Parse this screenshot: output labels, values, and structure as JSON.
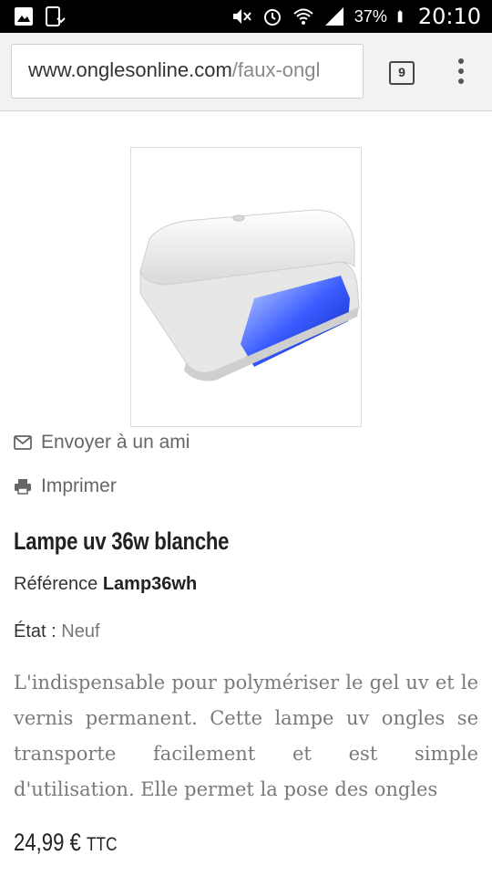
{
  "status_bar": {
    "battery_percent": "37%",
    "time": "20:10",
    "icons": [
      "gallery-icon",
      "download-icon",
      "mute-icon",
      "alarm-icon",
      "wifi-icon",
      "signal-icon",
      "battery-icon"
    ]
  },
  "browser": {
    "url_domain": "www.onglesonline.com",
    "url_path": "/faux-ongl",
    "tab_count": "9",
    "menu_icon": "overflow-menu-icon"
  },
  "product": {
    "image_alt": "uv-lamp-image",
    "send_friend_label": "Envoyer à un ami",
    "print_label": "Imprimer",
    "title": "Lampe uv 36w blanche",
    "reference_label": "Référence",
    "reference_value": "Lamp36wh",
    "state_label": "État :",
    "state_value": "Neuf",
    "description": "L'indispensable pour polymériser le gel uv et le vernis permanent. Cette lampe uv ongles se transporte facilement et est simple d'utilisation. Elle permet la pose des ongles",
    "price_value": "24,99 €",
    "price_suffix": "TTC"
  },
  "colors": {
    "status_bar_bg": "#000000",
    "toolbar_bg": "#f2f2f2",
    "lamp_glow": "#1f3cff",
    "description_text": "#7a7a7a"
  }
}
